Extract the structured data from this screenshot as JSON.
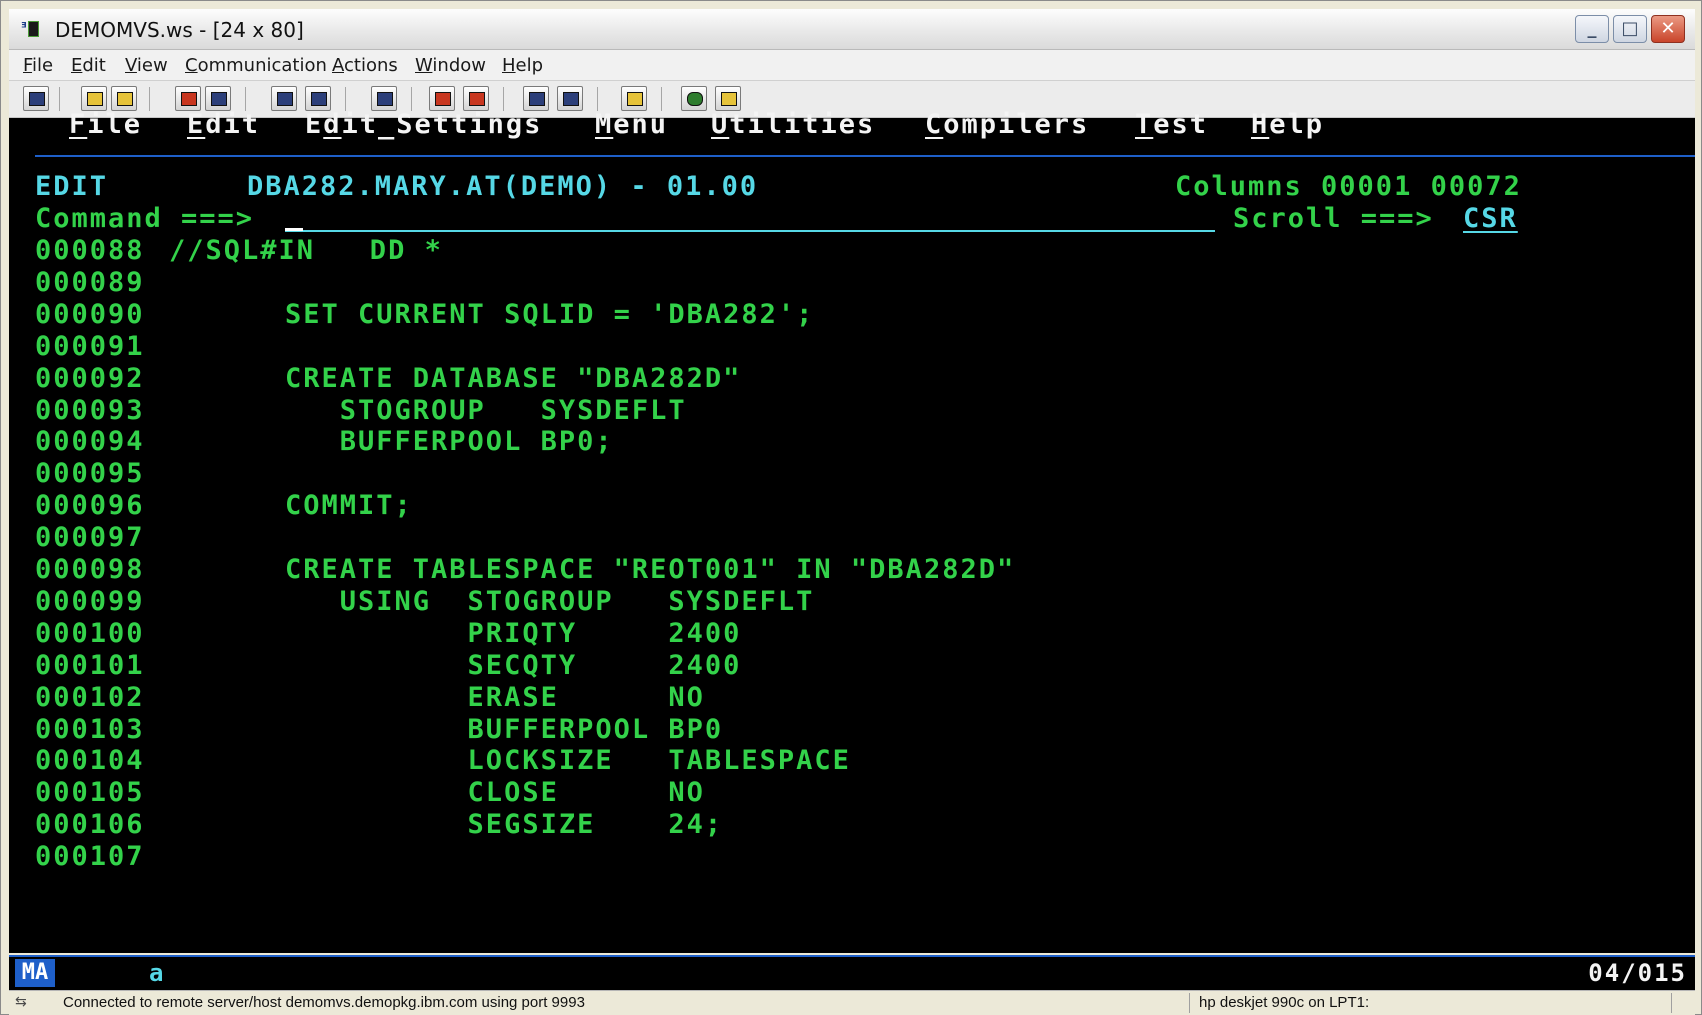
{
  "window": {
    "title": "DEMOMVS.ws - [24 x 80]",
    "controls": {
      "minimize": "_",
      "maximize": "□",
      "close": "✕"
    }
  },
  "menubar": [
    "File",
    "Edit",
    "View",
    "Communication",
    "Actions",
    "Window",
    "Help"
  ],
  "toolbar": {
    "icons": [
      "display-icon",
      "copy-icon",
      "paste-icon",
      "send-icon",
      "receive-icon",
      "screen-icon",
      "screen2-icon",
      "macro-icon",
      "record-icon",
      "play-icon",
      "print-icon",
      "print2-icon",
      "clipboard-icon",
      "globe-icon",
      "edit-pencil-icon"
    ]
  },
  "colors": {
    "terminal_bg": "#000000",
    "green": "#33d24a",
    "cyan": "#56d8e6",
    "white": "#f4f4f4",
    "blue": "#1e5fc9"
  },
  "ispf": {
    "menu": [
      "File",
      "Edit",
      "Edit_Settings",
      "Menu",
      "Utilities",
      "Compilers",
      "Test",
      "Help"
    ],
    "mode": "EDIT",
    "dataset": "DBA282.MARY.AT(DEMO) - 01.00",
    "columns": "Columns 00001 00072",
    "command_label": "Command ===>",
    "command_value": "",
    "scroll_label": "Scroll ===>",
    "scroll_value": "CSR",
    "lines": [
      {
        "num": "000088",
        "text": "//SQL#IN   DD *"
      },
      {
        "num": "000089",
        "text": ""
      },
      {
        "num": "000090",
        "text": "SET CURRENT SQLID = 'DBA282';"
      },
      {
        "num": "000091",
        "text": ""
      },
      {
        "num": "000092",
        "text": "CREATE DATABASE \"DBA282D\""
      },
      {
        "num": "000093",
        "text": "   STOGROUP   SYSDEFLT"
      },
      {
        "num": "000094",
        "text": "   BUFFERPOOL BP0;"
      },
      {
        "num": "000095",
        "text": ""
      },
      {
        "num": "000096",
        "text": "COMMIT;"
      },
      {
        "num": "000097",
        "text": ""
      },
      {
        "num": "000098",
        "text": "CREATE TABLESPACE \"REOT001\" IN \"DBA282D\""
      },
      {
        "num": "000099",
        "text": "   USING  STOGROUP   SYSDEFLT"
      },
      {
        "num": "000100",
        "text": "          PRIQTY     2400"
      },
      {
        "num": "000101",
        "text": "          SECQTY     2400"
      },
      {
        "num": "000102",
        "text": "          ERASE      NO"
      },
      {
        "num": "000103",
        "text": "          BUFFERPOOL BP0"
      },
      {
        "num": "000104",
        "text": "          LOCKSIZE   TABLESPACE"
      },
      {
        "num": "000105",
        "text": "          CLOSE      NO"
      },
      {
        "num": "000106",
        "text": "          SEGSIZE    24;"
      },
      {
        "num": "000107",
        "text": ""
      }
    ]
  },
  "oia": {
    "mode": "MA",
    "session": "a",
    "cursor_position": "04/015"
  },
  "statusbar": {
    "connection": "Connected to remote server/host demomvs.demopkg.ibm.com using port 9993",
    "printer": "hp deskjet 990c on LPT1:"
  }
}
